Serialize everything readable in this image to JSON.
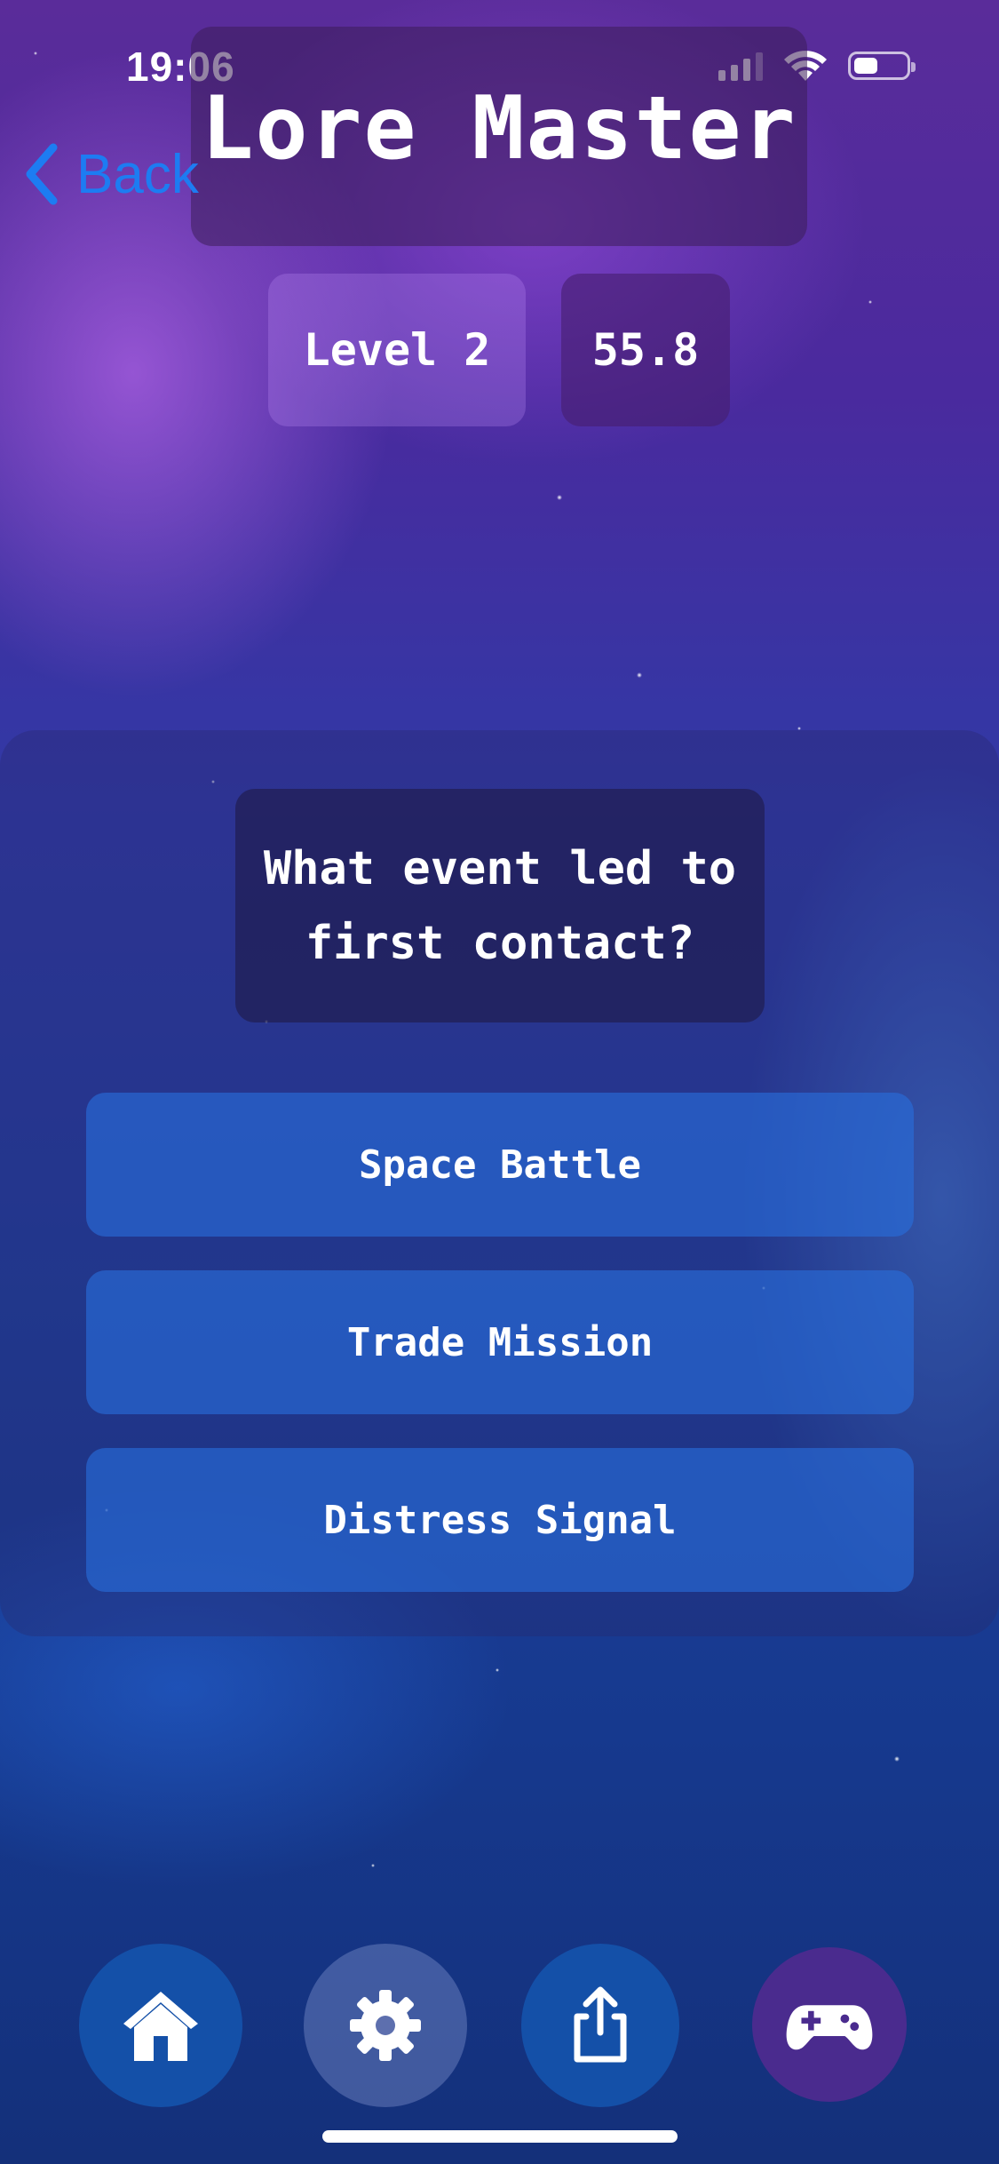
{
  "status_bar": {
    "time": "19:06"
  },
  "header": {
    "back_label": "Back",
    "title": "Lore Master"
  },
  "stats": {
    "level": "Level 2",
    "score": "55.8"
  },
  "quiz": {
    "question": "What event led to first contact?",
    "answers": [
      {
        "label": "Space Battle"
      },
      {
        "label": "Trade Mission"
      },
      {
        "label": "Distress Signal"
      }
    ]
  },
  "nav": {
    "items": [
      {
        "icon": "home-icon"
      },
      {
        "icon": "gear-icon"
      },
      {
        "icon": "share-icon"
      },
      {
        "icon": "gamepad-icon"
      }
    ]
  },
  "colors": {
    "back_link": "#1d7cf2",
    "answer_button": "#2d6edc",
    "nav_blue": "#1450a8",
    "nav_purple": "#4a2b8e"
  }
}
